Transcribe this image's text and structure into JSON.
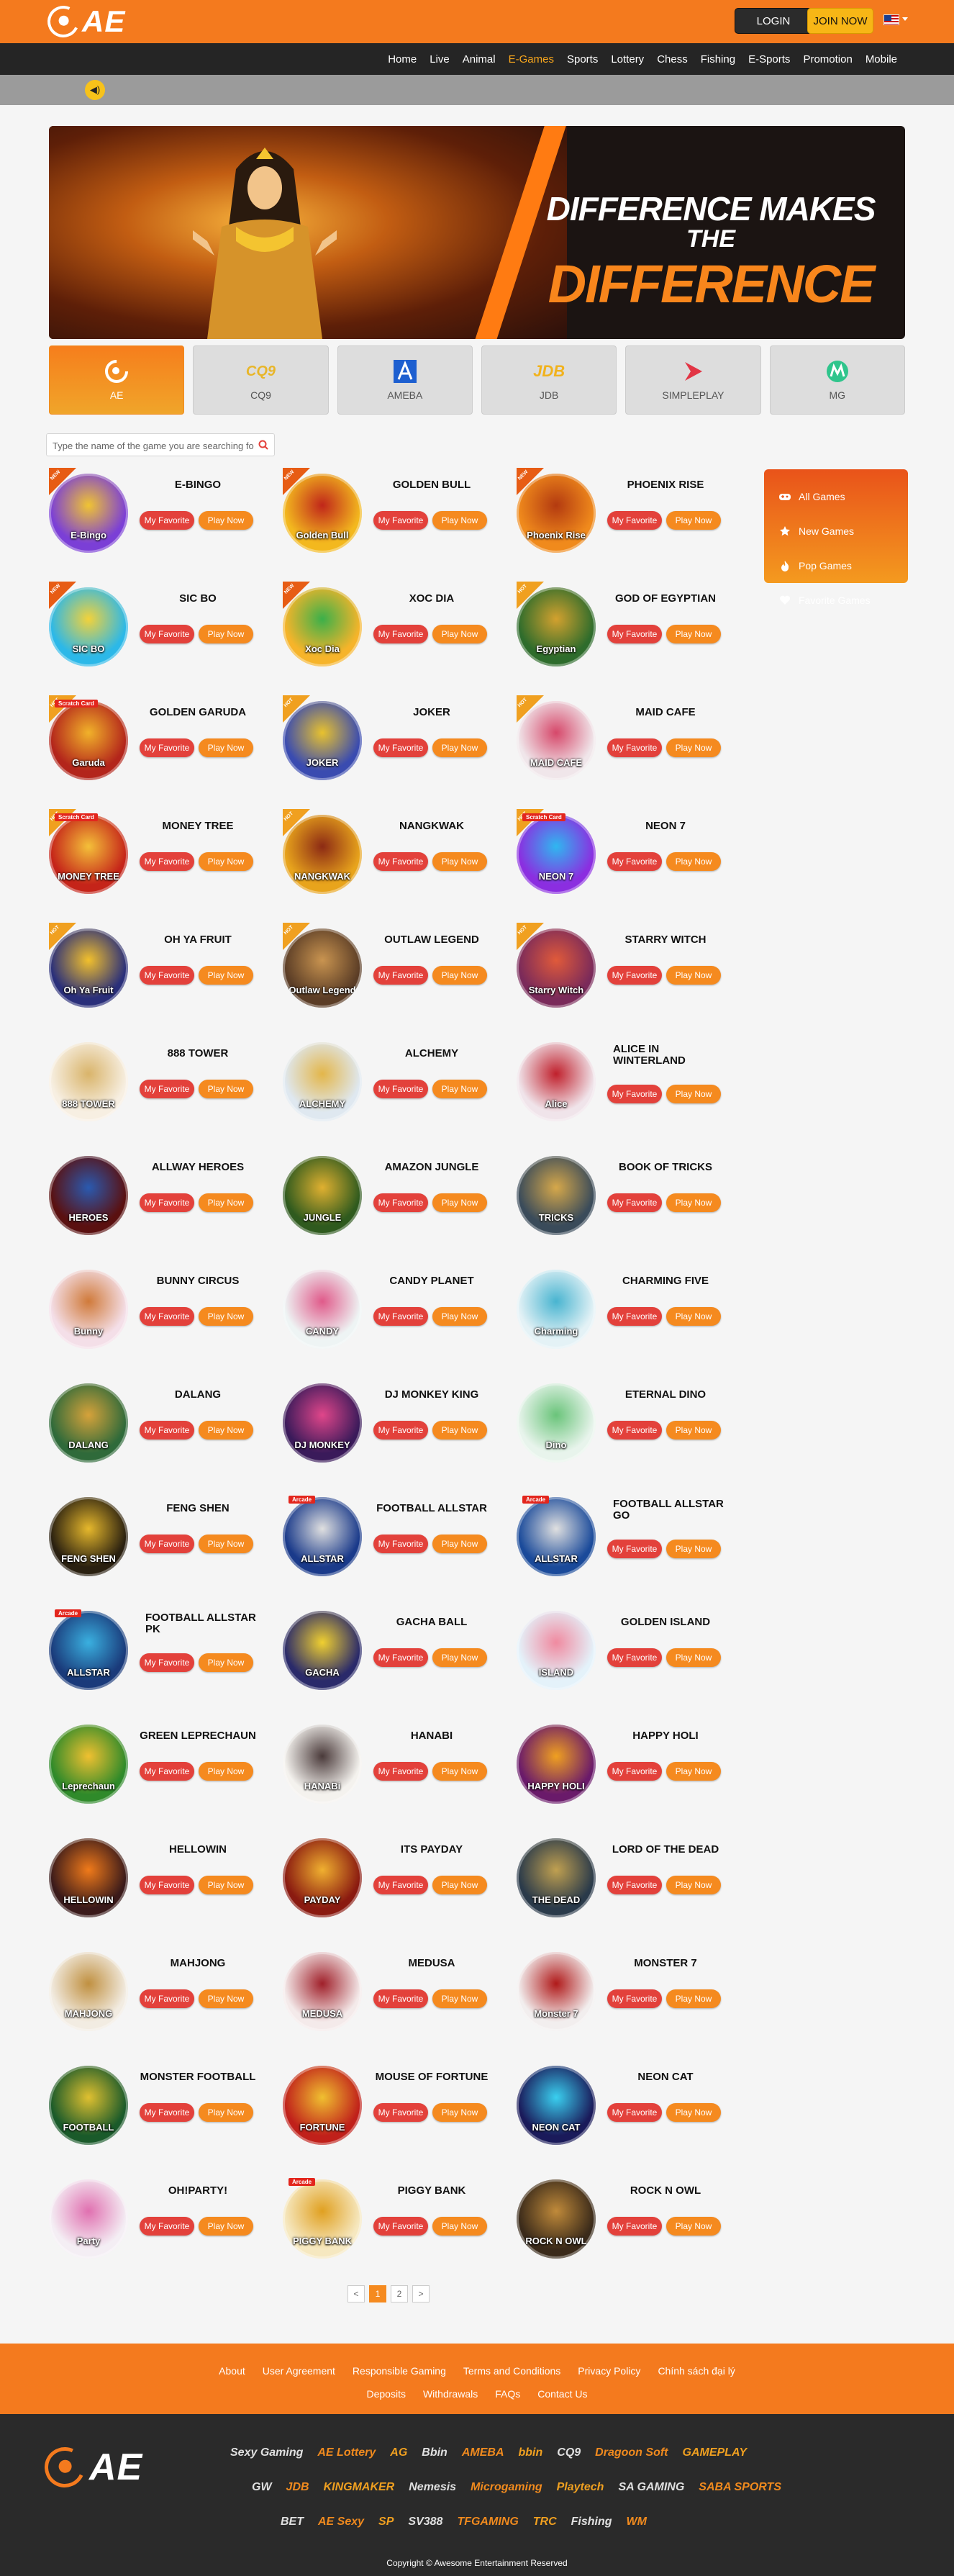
{
  "header": {
    "logo_text": "AE",
    "login_label": "LOGIN",
    "join_label": "JOIN NOW",
    "nav": [
      "Home",
      "Live",
      "Animal",
      "E-Games",
      "Sports",
      "Lottery",
      "Chess",
      "Fishing",
      "E-Sports",
      "Promotion",
      "Mobile"
    ],
    "active_nav": "E-Games"
  },
  "banner": {
    "line1": "DIFFERENCE MAKES",
    "the": "THE",
    "line2": "DIFFERENCE"
  },
  "providers": [
    {
      "label": "AE",
      "active": true
    },
    {
      "label": "CQ9",
      "active": false
    },
    {
      "label": "AMEBA",
      "active": false
    },
    {
      "label": "JDB",
      "active": false
    },
    {
      "label": "SIMPLEPLAY",
      "active": false
    },
    {
      "label": "MG",
      "active": false
    }
  ],
  "search": {
    "placeholder": "Type the name of the game you are searching for"
  },
  "categories": [
    "All Games",
    "New Games",
    "Pop Games",
    "Favorite Games"
  ],
  "buttons": {
    "favorite": "My Favorite",
    "play": "Play Now"
  },
  "ribbon_texts": {
    "new": "NEW",
    "hot": "HOT"
  },
  "games": [
    {
      "name": "E-BINGO",
      "thumb": "E-Bingo",
      "tag": "new",
      "colors": [
        "#7b3fd6",
        "#f0c432"
      ]
    },
    {
      "name": "GOLDEN BULL",
      "thumb": "Golden Bull",
      "tag": "new",
      "colors": [
        "#f3b81e",
        "#c0261a"
      ]
    },
    {
      "name": "PHOENIX RISE",
      "thumb": "Phoenix Rise",
      "tag": "new",
      "colors": [
        "#f08a1c",
        "#b33a10"
      ]
    },
    {
      "name": "SIC BO",
      "thumb": "SIC BO",
      "tag": "new",
      "colors": [
        "#2cb8e8",
        "#f3d23a"
      ]
    },
    {
      "name": "XOC DIA",
      "thumb": "Xoc Dia",
      "tag": "new",
      "colors": [
        "#f6b42a",
        "#3bb04a"
      ]
    },
    {
      "name": "GOD OF EGYPTIAN",
      "thumb": "Egyptian",
      "tag": "hot",
      "colors": [
        "#2e6c2c",
        "#d3a12e"
      ]
    },
    {
      "name": "GOLDEN GARUDA",
      "thumb": "Garuda",
      "tag": "hot",
      "badge": "Scratch Card",
      "colors": [
        "#b3251b",
        "#f1b22a"
      ]
    },
    {
      "name": "JOKER",
      "thumb": "JOKER",
      "tag": "hot",
      "colors": [
        "#3a4bb0",
        "#e8c22e"
      ]
    },
    {
      "name": "MAID CAFE",
      "thumb": "MAID CAFE",
      "tag": "hot",
      "colors": [
        "#f0e6ea",
        "#d6486a"
      ]
    },
    {
      "name": "MONEY TREE",
      "thumb": "MONEY TREE",
      "tag": "hot",
      "badge": "Scratch Card",
      "colors": [
        "#c52419",
        "#f4c039"
      ]
    },
    {
      "name": "NANGKWAK",
      "thumb": "NANGKWAK",
      "tag": "hot",
      "colors": [
        "#e8a41c",
        "#8c2a14"
      ]
    },
    {
      "name": "NEON 7",
      "thumb": "NEON 7",
      "tag": "hot",
      "badge": "Scratch Card",
      "colors": [
        "#8b2ee0",
        "#2fb7f0"
      ]
    },
    {
      "name": "OH YA FRUIT",
      "thumb": "Oh Ya Fruit",
      "tag": "hot",
      "colors": [
        "#2a2f7a",
        "#f2c02c"
      ]
    },
    {
      "name": "OUTLAW LEGEND",
      "thumb": "Outlaw Legend",
      "tag": "hot",
      "colors": [
        "#5b3d26",
        "#c99450"
      ]
    },
    {
      "name": "STARRY WITCH",
      "thumb": "Starry Witch",
      "tag": "hot",
      "colors": [
        "#7a2a5a",
        "#e05a3a"
      ]
    },
    {
      "name": "888 TOWER",
      "thumb": "888 TOWER",
      "colors": [
        "#f7efe2",
        "#d9b46a"
      ]
    },
    {
      "name": "ALCHEMY",
      "thumb": "ALCHEMY",
      "colors": [
        "#dfe8f0",
        "#e3b64a"
      ]
    },
    {
      "name": "ALICE IN WINTERLAND",
      "thumb": "Alice",
      "colors": [
        "#f0e4ea",
        "#c0202c"
      ]
    },
    {
      "name": "ALLWAY HEROES",
      "thumb": "HEROES",
      "colors": [
        "#5a1010",
        "#2a5ab0"
      ]
    },
    {
      "name": "AMAZON JUNGLE",
      "thumb": "JUNGLE",
      "colors": [
        "#2f5a1e",
        "#e0b030"
      ]
    },
    {
      "name": "BOOK OF TRICKS",
      "thumb": "TRICKS",
      "colors": [
        "#3a4b5a",
        "#d6a84a"
      ]
    },
    {
      "name": "BUNNY CIRCUS",
      "thumb": "Bunny",
      "colors": [
        "#f4dfe8",
        "#d07a3a"
      ]
    },
    {
      "name": "CANDY PLANET",
      "thumb": "CANDY",
      "colors": [
        "#eef4f4",
        "#e05a8a"
      ]
    },
    {
      "name": "CHARMING FIVE",
      "thumb": "Charming",
      "colors": [
        "#e4f2f6",
        "#48b4d0"
      ]
    },
    {
      "name": "DALANG",
      "thumb": "DALANG",
      "colors": [
        "#2f6a3a",
        "#d6a23a"
      ]
    },
    {
      "name": "DJ MONKEY KING",
      "thumb": "DJ MONKEY",
      "colors": [
        "#3a1a5a",
        "#e0468a"
      ]
    },
    {
      "name": "ETERNAL DINO",
      "thumb": "Dino",
      "colors": [
        "#e8f4ec",
        "#6ac47a"
      ]
    },
    {
      "name": "FENG SHEN",
      "thumb": "FENG SHEN",
      "colors": [
        "#2a2010",
        "#e6b82c"
      ]
    },
    {
      "name": "FOOTBALL ALLSTAR",
      "thumb": "ALLSTAR",
      "badge": "Arcade",
      "colors": [
        "#1a3a8a",
        "#e0e0e0"
      ]
    },
    {
      "name": "FOOTBALL ALLSTAR GO",
      "thumb": "ALLSTAR",
      "badge": "Arcade",
      "colors": [
        "#1a4a9a",
        "#e0e0e0"
      ]
    },
    {
      "name": "FOOTBALL ALLSTAR PK",
      "thumb": "ALLSTAR",
      "badge": "Arcade",
      "colors": [
        "#1a3a7a",
        "#3ab0e0"
      ]
    },
    {
      "name": "GACHA BALL",
      "thumb": "GACHA",
      "colors": [
        "#2a2a6a",
        "#f0d030"
      ]
    },
    {
      "name": "GOLDEN ISLAND",
      "thumb": "ISLAND",
      "colors": [
        "#e4f2fa",
        "#f08aa0"
      ]
    },
    {
      "name": "GREEN LEPRECHAUN",
      "thumb": "Leprechaun",
      "colors": [
        "#2f8a2a",
        "#f0c030"
      ]
    },
    {
      "name": "HANABI",
      "thumb": "HANABi",
      "colors": [
        "#f4f2ee",
        "#4a3a3a"
      ]
    },
    {
      "name": "HAPPY HOLI",
      "thumb": "HAPPY HOLI",
      "colors": [
        "#6a1a6a",
        "#f0a020"
      ]
    },
    {
      "name": "HELLOWIN",
      "thumb": "HELLOWIN",
      "colors": [
        "#3a1a1a",
        "#f07a1a"
      ]
    },
    {
      "name": "ITS PAYDAY",
      "thumb": "PAYDAY",
      "colors": [
        "#8a1a10",
        "#f0b030"
      ]
    },
    {
      "name": "LORD OF THE DEAD",
      "thumb": "THE DEAD",
      "colors": [
        "#2a3a4a",
        "#c0a050"
      ]
    },
    {
      "name": "MAHJONG",
      "thumb": "MAHJONG",
      "colors": [
        "#f2ece2",
        "#c09040"
      ]
    },
    {
      "name": "MEDUSA",
      "thumb": "MEDUSA",
      "colors": [
        "#f4eaea",
        "#a0202a"
      ]
    },
    {
      "name": "MONSTER 7",
      "thumb": "Monster 7",
      "colors": [
        "#f2eeee",
        "#b01a1a"
      ]
    },
    {
      "name": "MONSTER FOOTBALL",
      "thumb": "FOOTBALL",
      "colors": [
        "#1a5a2a",
        "#e0c030"
      ]
    },
    {
      "name": "MOUSE OF FORTUNE",
      "thumb": "FORTUNE",
      "colors": [
        "#c0201a",
        "#f0c030"
      ]
    },
    {
      "name": "NEON CAT",
      "thumb": "NEON CAT",
      "colors": [
        "#1a1a5a",
        "#3ad0f0"
      ]
    },
    {
      "name": "OH!PARTY!",
      "thumb": "Party",
      "colors": [
        "#f4eef4",
        "#e070b0"
      ]
    },
    {
      "name": "PIGGY BANK",
      "thumb": "PIGGY BANK",
      "badge": "Arcade",
      "colors": [
        "#f6e8c0",
        "#e0a020"
      ]
    },
    {
      "name": "ROCK N OWL",
      "thumb": "ROCK N OWL",
      "colors": [
        "#3a2a1a",
        "#c08a3a"
      ]
    }
  ],
  "pagination": {
    "prev": "<",
    "pages": [
      "1",
      "2"
    ],
    "next": ">",
    "current": "1"
  },
  "footer": {
    "links_row1": [
      "About",
      "User Agreement",
      "Responsible Gaming",
      "Terms and Conditions",
      "Privacy Policy",
      "Chính sách đại lý"
    ],
    "links_row2": [
      "Deposits",
      "Withdrawals",
      "FAQs",
      "Contact Us"
    ],
    "partners_row1": [
      "Sexy Gaming",
      "AE Lottery",
      "AG",
      "Bbin",
      "AMEBA",
      "bbin",
      "CQ9",
      "Dragoon Soft",
      "GAMEPLAY"
    ],
    "partners_row2": [
      "GW",
      "JDB",
      "KINGMAKER",
      "Nemesis",
      "Microgaming",
      "Playtech",
      "SA GAMING",
      "SABA SPORTS"
    ],
    "partners_row3": [
      "BET",
      "AE Sexy",
      "SP",
      "SV388",
      "TFGAMING",
      "TRC",
      "Fishing",
      "WM"
    ],
    "copyright": "Copyright © Awesome Entertainment Reserved"
  }
}
